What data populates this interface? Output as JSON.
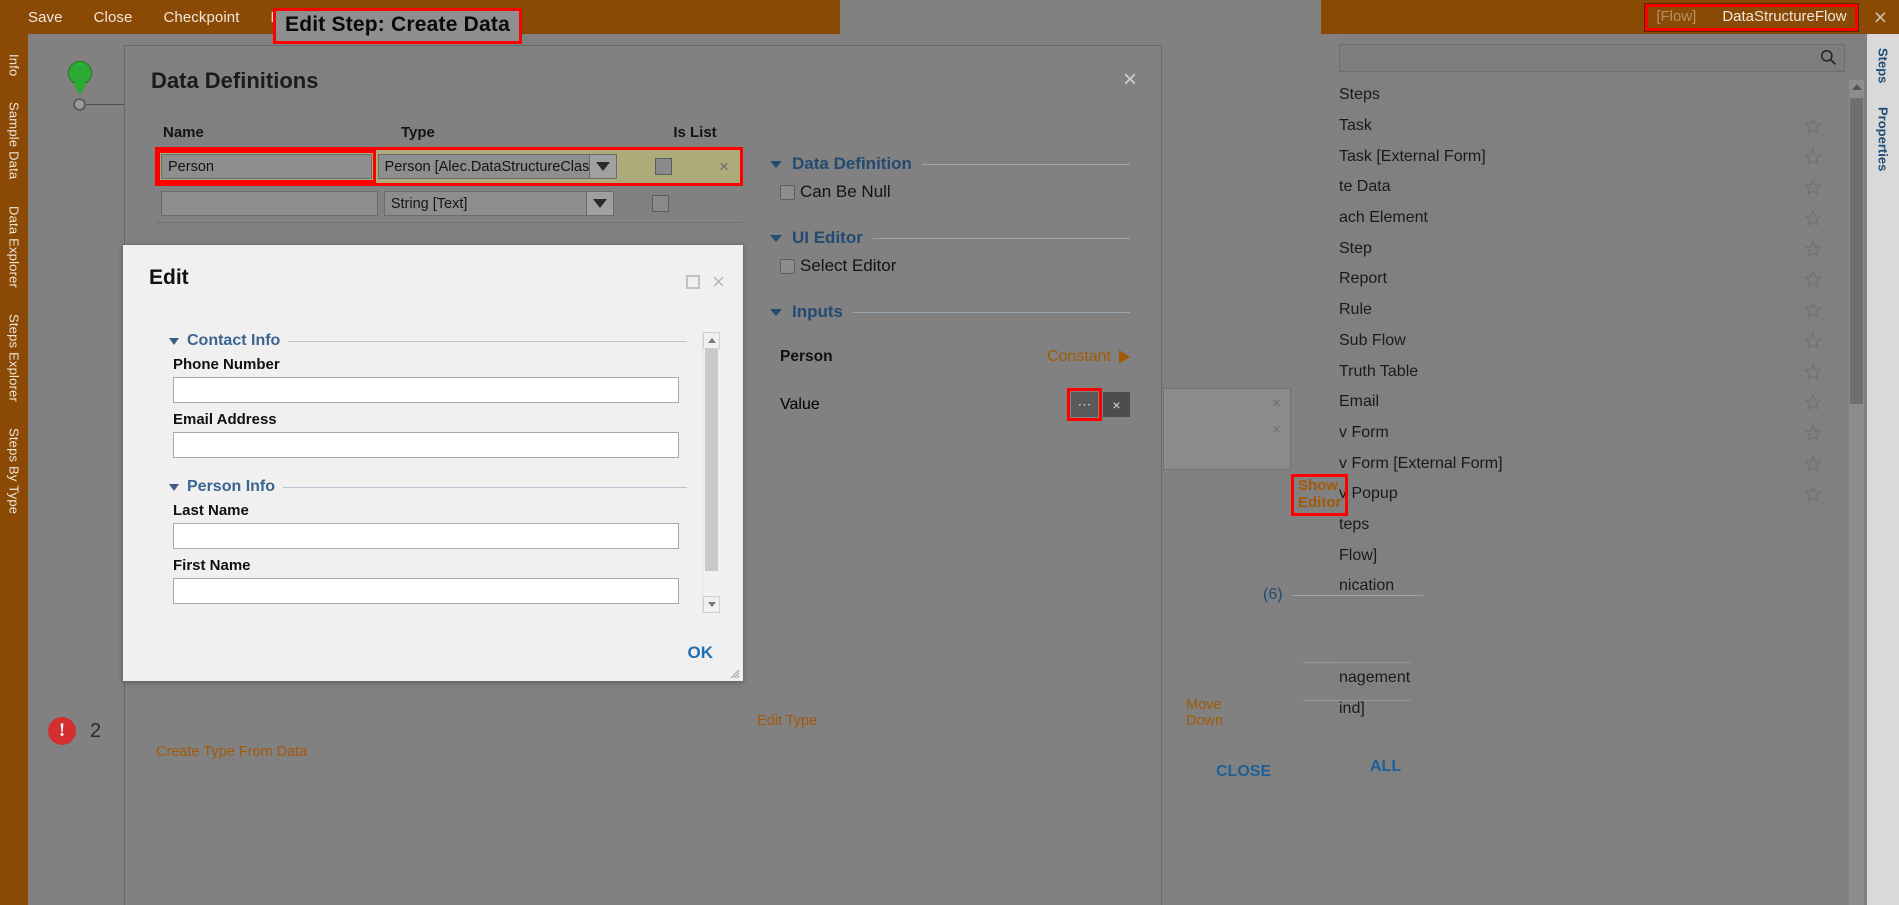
{
  "toolbar": {
    "items": [
      {
        "label": "Save"
      },
      {
        "label": "Close"
      },
      {
        "label": "Checkpoint"
      },
      {
        "label": "Debug"
      }
    ]
  },
  "flow_tab": {
    "tag": "[Flow]",
    "name": "DataStructureFlow",
    "close": "×"
  },
  "banner": {
    "text": "Edit Step: Create Data"
  },
  "left_rail": {
    "items": [
      {
        "label": "Info"
      },
      {
        "label": "Sample Data"
      },
      {
        "label": "Data Explorer"
      },
      {
        "label": "Steps Explorer"
      },
      {
        "label": "Steps By Type"
      }
    ]
  },
  "far_rail": {
    "items": [
      {
        "label": "Steps"
      },
      {
        "label": "Properties"
      }
    ]
  },
  "canvas": {
    "error_count": "2"
  },
  "steps_panel": {
    "search_value": "",
    "search_placeholder": "",
    "rows": [
      {
        "label": "Steps",
        "star": false
      },
      {
        "label": "Task",
        "star": true
      },
      {
        "label": "Task [External Form]",
        "star": true
      },
      {
        "label": "te Data",
        "star": true
      },
      {
        "label": "ach Element",
        "star": true
      },
      {
        "label": "Step",
        "star": true
      },
      {
        "label": "Report",
        "star": true
      },
      {
        "label": "Rule",
        "star": true
      },
      {
        "label": "Sub Flow",
        "star": true
      },
      {
        "label": "Truth Table",
        "star": true
      },
      {
        "label": "Email",
        "star": true
      },
      {
        "label": "v Form",
        "star": true
      },
      {
        "label": "v Form [External Form]",
        "star": true
      },
      {
        "label": "v Popup",
        "star": true
      },
      {
        "label": "teps",
        "star": false
      },
      {
        "label": "Flow]",
        "star": false
      },
      {
        "label": "nication",
        "star": false
      },
      {
        "label": "",
        "star": false
      },
      {
        "label": "",
        "star": false
      },
      {
        "label": "nagement",
        "star": false
      },
      {
        "label": "ind]",
        "star": false
      }
    ]
  },
  "data_definitions": {
    "title": "Data Definitions",
    "close": "×",
    "columns": {
      "name": "Name",
      "type": "Type",
      "is_list": "Is List"
    },
    "rows": [
      {
        "name": "Person",
        "type": "Person   [Alec.DataStructureClas",
        "is_list": false,
        "selected": true,
        "delete": "×"
      },
      {
        "name": "",
        "type": "String [Text]",
        "is_list": false,
        "selected": false,
        "delete": ""
      }
    ],
    "create_type_from_data": "Create Type From Data",
    "edit_type": "Edit Type",
    "move_down": "Move Down",
    "close_button": "CLOSE",
    "all_button": "ALL",
    "group_count": "(6)",
    "show_editor": "Show Editor",
    "sections": [
      {
        "title": "Data Definition"
      },
      {
        "title": "UI Editor"
      },
      {
        "title": "Inputs"
      }
    ],
    "can_be_null": "Can Be Null",
    "select_editor": "Select Editor",
    "person_label": "Person",
    "person_value": "Constant",
    "value_label": "Value",
    "value_ellipsis": "⋯",
    "value_clear": "×"
  },
  "edit_dialog": {
    "title": "Edit",
    "close": "×",
    "ok": "OK",
    "sections": [
      {
        "title": "Contact Info",
        "fields": [
          {
            "label": "Phone Number",
            "value": ""
          },
          {
            "label": "Email Address",
            "value": ""
          }
        ]
      },
      {
        "title": "Person Info",
        "fields": [
          {
            "label": "Last Name",
            "value": ""
          },
          {
            "label": "First Name",
            "value": ""
          }
        ]
      }
    ]
  },
  "colors": {
    "toolbar_orange": "#8a4a06",
    "highlight_red": "#ff0000",
    "link_blue": "#1f5f96",
    "section_blue": "#234b72",
    "accent_orange": "#a25a08",
    "selected_row": "#adab79",
    "error_red": "#d32f2f"
  }
}
